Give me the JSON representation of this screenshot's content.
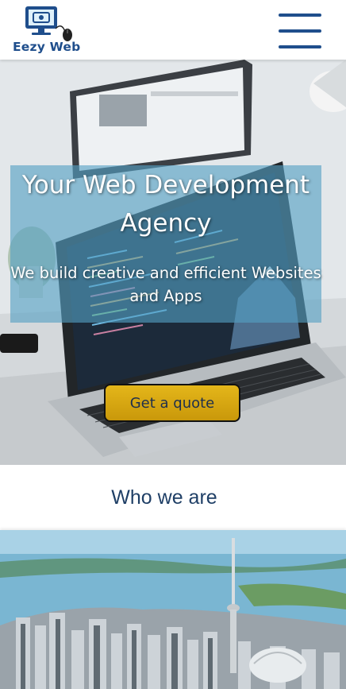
{
  "header": {
    "logo_text": "Eezy Web",
    "logo_icon": "computer-mouse-icon",
    "menu_icon": "hamburger-menu-icon"
  },
  "hero": {
    "title": "Your Web Development Agency",
    "subtitle": "We build creative and efficient Websites and Apps",
    "cta_label": "Get a quote"
  },
  "about": {
    "heading": "Who we are"
  },
  "colors": {
    "brand_blue": "#1f4e8c",
    "cta_gold": "#d8a810",
    "heading_navy": "#1f3f66",
    "hero_overlay": "#54a0c4"
  }
}
